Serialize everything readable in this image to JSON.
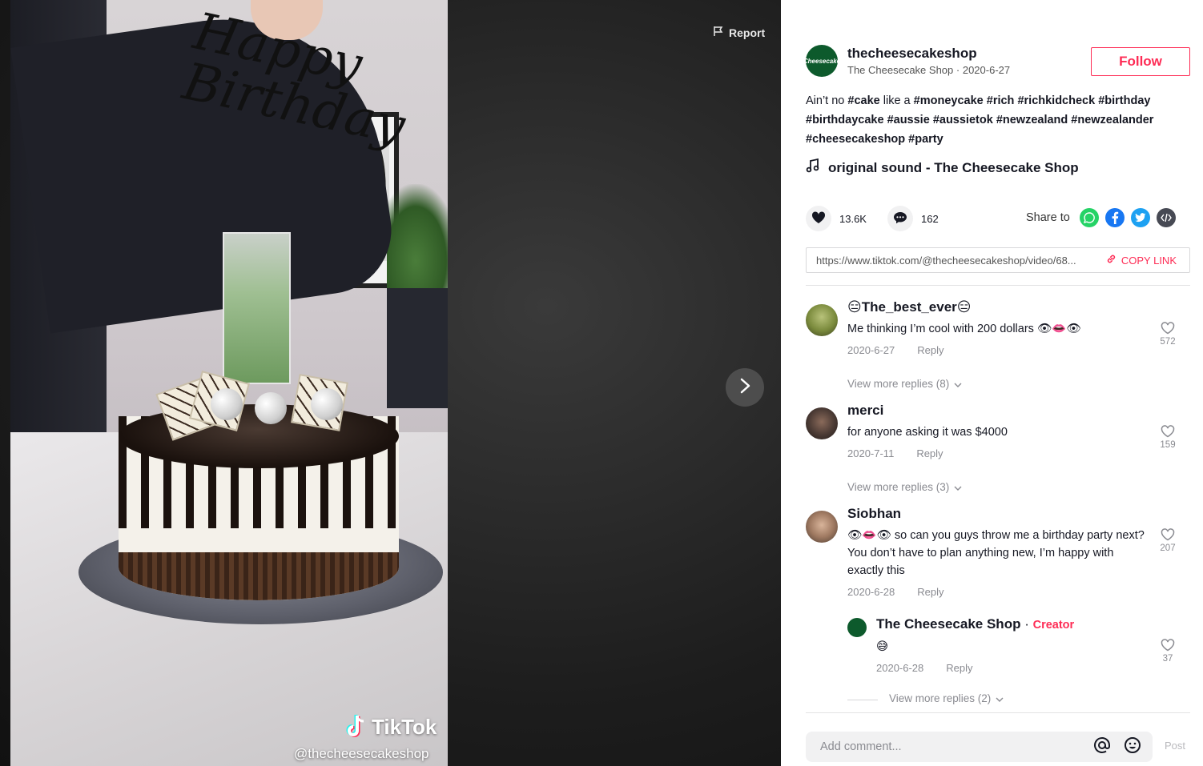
{
  "video": {
    "topper_text": "Happy Birthday",
    "watermark_logo": "TikTok",
    "watermark_handle": "@thecheesecakeshop",
    "report_label": "Report",
    "next_icon": "chevron-right-icon"
  },
  "author": {
    "username": "thecheesecakeshop",
    "display_name": "The Cheesecake Shop",
    "date": "2020-6-27",
    "avatar_text": "Cheesecake",
    "follow_label": "Follow"
  },
  "caption": {
    "text_prefix": "Ain’t no ",
    "segments": [
      {
        "text": "#cake",
        "tag": true
      },
      {
        "text": " like a ",
        "tag": false
      },
      {
        "text": "#moneycake",
        "tag": true
      },
      {
        "text": " ",
        "tag": false
      },
      {
        "text": "#rich",
        "tag": true
      },
      {
        "text": " ",
        "tag": false
      },
      {
        "text": "#richkidcheck",
        "tag": true
      },
      {
        "text": " ",
        "tag": false
      },
      {
        "text": "#birthday",
        "tag": true
      },
      {
        "text": " ",
        "tag": false
      },
      {
        "text": "#birthdaycake",
        "tag": true
      },
      {
        "text": " ",
        "tag": false
      },
      {
        "text": "#aussie",
        "tag": true
      },
      {
        "text": " ",
        "tag": false
      },
      {
        "text": "#aussietok",
        "tag": true
      },
      {
        "text": " ",
        "tag": false
      },
      {
        "text": "#newzealand",
        "tag": true
      },
      {
        "text": " ",
        "tag": false
      },
      {
        "text": "#newzealander",
        "tag": true
      },
      {
        "text": " ",
        "tag": false
      },
      {
        "text": "#cheesecakeshop",
        "tag": true
      },
      {
        "text": " ",
        "tag": false
      },
      {
        "text": "#party",
        "tag": true
      }
    ]
  },
  "sound": {
    "label": "original sound - The Cheesecake Shop",
    "icon": "music-note-icon"
  },
  "stats": {
    "likes": "13.6K",
    "comments": "162"
  },
  "share": {
    "label": "Share to",
    "targets": [
      {
        "name": "whatsapp-icon",
        "color": "#25d366"
      },
      {
        "name": "facebook-icon",
        "color": "#1877f2"
      },
      {
        "name": "twitter-icon",
        "color": "#1da1f2"
      },
      {
        "name": "embed-icon",
        "color": "#474a54"
      }
    ]
  },
  "link": {
    "url": "https://www.tiktok.com/@thecheesecakeshop/video/68...",
    "copy_label": "COPY LINK"
  },
  "comments": [
    {
      "name": "😑The_best_ever😑",
      "text": "Me thinking I’m cool with 200 dollars 👁👄👁",
      "date": "2020-6-27",
      "reply_label": "Reply",
      "likes": "572",
      "more_replies": "View more replies (8)"
    },
    {
      "name": "merci",
      "text": "for anyone asking it was $4000",
      "date": "2020-7-11",
      "reply_label": "Reply",
      "likes": "159",
      "more_replies": "View more replies (3)"
    },
    {
      "name": "Siobhan",
      "text": "👁👄👁 so can you guys throw me a birthday party next? You don’t have to plan anything new, I’m happy with exactly this",
      "date": "2020-6-28",
      "reply_label": "Reply",
      "likes": "207"
    }
  ],
  "creator_reply": {
    "name": "The Cheesecake Shop",
    "separator": "·",
    "badge": "Creator",
    "text": "😅",
    "date": "2020-6-28",
    "reply_label": "Reply",
    "likes": "37",
    "more_replies": "View more replies (2)"
  },
  "add_comment": {
    "placeholder": "Add comment...",
    "post_label": "Post"
  },
  "colors": {
    "accent": "#fe2c55",
    "text": "#161823",
    "muted": "#8a8b91"
  }
}
